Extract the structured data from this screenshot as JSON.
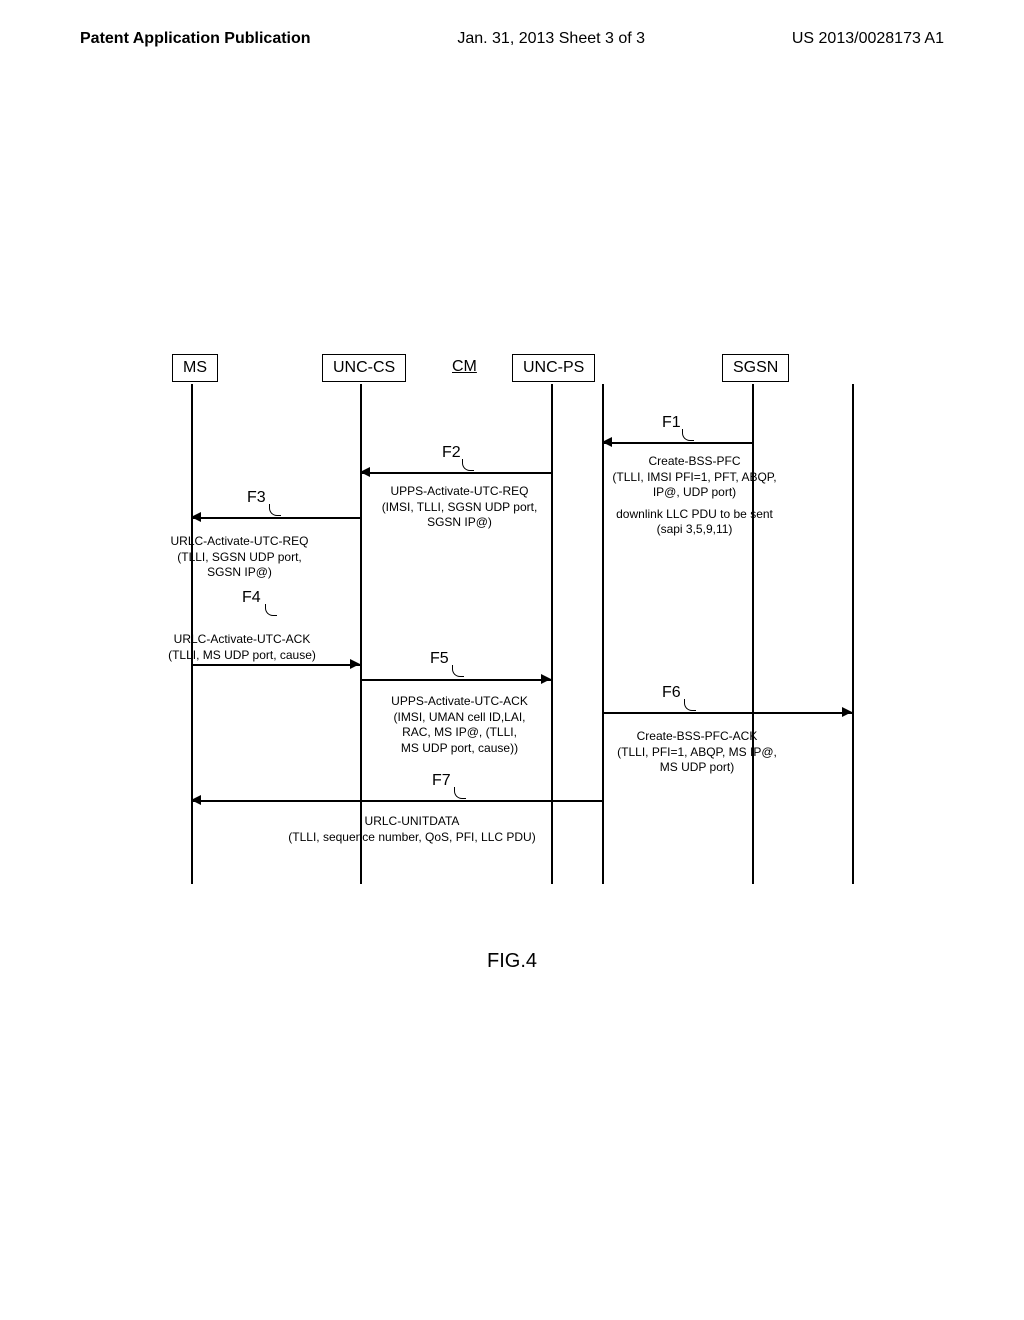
{
  "header": {
    "left": "Patent Application Publication",
    "center": "Jan. 31, 2013  Sheet 3 of 3",
    "right": "US 2013/0028173 A1"
  },
  "entities": {
    "ms": "MS",
    "unc_cs": "UNC-CS",
    "cm": "CM",
    "unc_ps": "UNC-PS",
    "sgsn": "SGSN"
  },
  "steps": {
    "f1": "F1",
    "f2": "F2",
    "f3": "F3",
    "f4": "F4",
    "f5": "F5",
    "f6": "F6",
    "f7": "F7"
  },
  "messages": {
    "f1_line1": "Create-BSS-PFC",
    "f1_line2": "(TLLI, IMSI PFI=1, PFT, ABQP,",
    "f1_line3": "IP@, UDP port)",
    "f1_line4": "downlink LLC PDU to be sent",
    "f1_line5": "(sapi 3,5,9,11)",
    "f2_line1": "UPPS-Activate-UTC-REQ",
    "f2_line2": "(IMSI, TLLI, SGSN UDP port,",
    "f2_line3": "SGSN IP@)",
    "f3_line1": "URLC-Activate-UTC-REQ",
    "f3_line2": "(TLLI, SGSN UDP port,",
    "f3_line3": "SGSN IP@)",
    "f4_line1": "URLC-Activate-UTC-ACK",
    "f4_line2": "(TLLI, MS UDP port, cause)",
    "f5_line1": "UPPS-Activate-UTC-ACK",
    "f5_line2": "(IMSI, UMAN cell ID,LAI,",
    "f5_line3": "RAC, MS IP@, (TLLI,",
    "f5_line4": "MS UDP port, cause))",
    "f6_line1": "Create-BSS-PFC-ACK",
    "f6_line2": "(TLLI, PFI=1, ABQP, MS IP@,",
    "f6_line3": "MS UDP port)",
    "f7_line1": "URLC-UNITDATA",
    "f7_line2": "(TLLI, sequence number, QoS, PFI, LLC PDU)"
  },
  "caption": "FIG.4",
  "chart_data": {
    "type": "sequence-diagram",
    "participants": [
      "MS",
      "UNC-CS",
      "CM",
      "UNC-PS",
      "SGSN"
    ],
    "messages": [
      {
        "id": "F1",
        "from": "SGSN",
        "to": "UNC-PS",
        "label": "Create-BSS-PFC (TLLI, IMSI PFI=1, PFT, ABQP, IP@, UDP port) downlink LLC PDU to be sent (sapi 3,5,9,11)"
      },
      {
        "id": "F2",
        "from": "UNC-PS",
        "to": "UNC-CS",
        "label": "UPPS-Activate-UTC-REQ (IMSI, TLLI, SGSN UDP port, SGSN IP@)"
      },
      {
        "id": "F3",
        "from": "UNC-CS",
        "to": "MS",
        "label": "URLC-Activate-UTC-REQ (TLLI, SGSN UDP port, SGSN IP@)"
      },
      {
        "id": "F4",
        "from": "MS",
        "to": "UNC-CS",
        "label": "URLC-Activate-UTC-ACK (TLLI, MS UDP port, cause)"
      },
      {
        "id": "F5",
        "from": "UNC-CS",
        "to": "UNC-PS",
        "label": "UPPS-Activate-UTC-ACK (IMSI, UMAN cell ID,LAI, RAC, MS IP@, (TLLI, MS UDP port, cause))"
      },
      {
        "id": "F6",
        "from": "UNC-PS",
        "to": "SGSN",
        "label": "Create-BSS-PFC-ACK (TLLI, PFI=1, ABQP, MS IP@, MS UDP port)"
      },
      {
        "id": "F7",
        "from": "UNC-PS",
        "to": "MS",
        "label": "URLC-UNITDATA (TLLI, sequence number, QoS, PFI, LLC PDU)"
      }
    ]
  }
}
